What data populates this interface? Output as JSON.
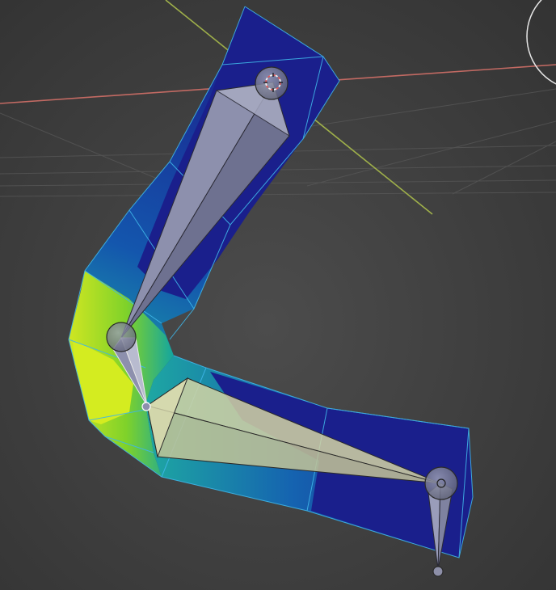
{
  "viewport": {
    "view": "3d-viewport",
    "mode": "weight-paint",
    "background_color": "#3d3d3d",
    "grid_line_color": "#555555",
    "x_axis_color": "#c36a63",
    "y_axis_color": "#9fb04a"
  },
  "mesh": {
    "name": "bent-arm-mesh",
    "edge_color": "#3fb6e8",
    "weight_gradient": [
      "#1a1f8c",
      "#1450a8",
      "#11a0a6",
      "#7fd22a",
      "#d6ee1f"
    ]
  },
  "armature": {
    "bone_color": "#9a9dba",
    "selected_bone_color": "#d3d3a3",
    "bones": [
      {
        "id": "upper-bone",
        "selected": false
      },
      {
        "id": "twist-bone",
        "selected": false
      },
      {
        "id": "lower-bone",
        "selected": true
      },
      {
        "id": "tip-bone",
        "selected": false
      }
    ]
  },
  "cursor_3d": {
    "visible": true,
    "color": "#e05a5a"
  }
}
